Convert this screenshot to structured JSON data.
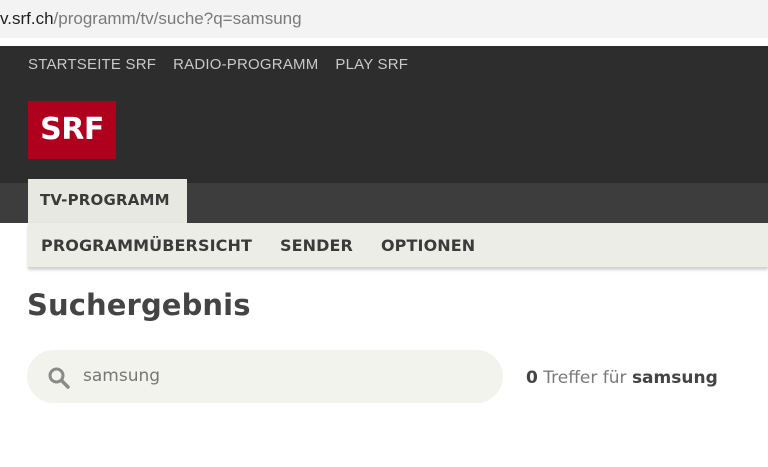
{
  "browser": {
    "url_host": "v.srf.ch",
    "url_path": "/programm/tv/suche?q=samsung"
  },
  "header": {
    "topnav": [
      "STARTSEITE SRF",
      "RADIO-PROGRAMM",
      "PLAY SRF"
    ],
    "logo_text": "SRF"
  },
  "tabs": {
    "active_label": "TV-PROGRAMM"
  },
  "subnav": [
    "PROGRAMMÜBERSICHT",
    "SENDER",
    "OPTIONEN"
  ],
  "main": {
    "title": "Suchergebnis",
    "search": {
      "value": "samsung",
      "placeholder": "samsung",
      "icon": "search-icon"
    },
    "results": {
      "count": "0",
      "label": "Treffer für",
      "query": "samsung"
    }
  },
  "colors": {
    "brand_red": "#af001e",
    "header_bg": "#2d2d2d",
    "content_bg": "#e2dfd8"
  }
}
